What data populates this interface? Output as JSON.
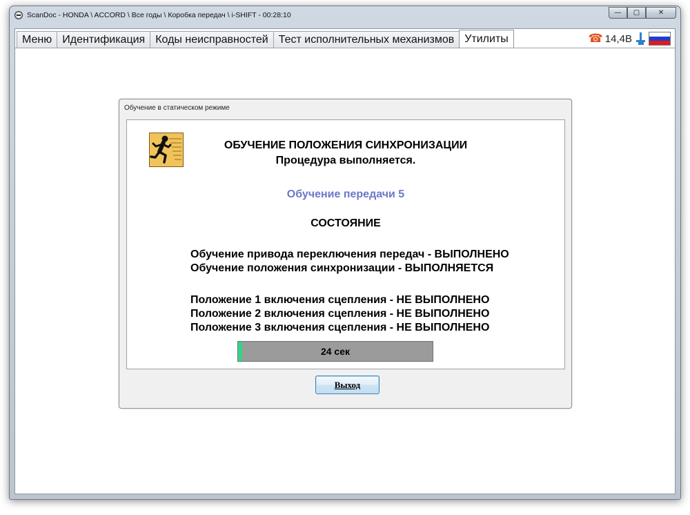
{
  "window": {
    "title": "ScanDoc - HONDA \\ ACCORD \\ Все годы \\ Коробка передач \\ i-SHIFT - 00:28:10",
    "controls": {
      "minimize": "—",
      "maximize": "▢",
      "close": "✕"
    }
  },
  "tabs": [
    {
      "label": "Меню"
    },
    {
      "label": "Идентификация"
    },
    {
      "label": "Коды неисправностей"
    },
    {
      "label": "Тест исполнительных механизмов"
    },
    {
      "label": "Утилиты",
      "active": true
    }
  ],
  "status": {
    "voltage": "14,4В",
    "phone_icon": "☎",
    "flag_colors": [
      "#ffffff",
      "#1c3fd1",
      "#e01b1b"
    ]
  },
  "dialog": {
    "title": "Обучение в статическом режиме",
    "heading_line1": "ОБУЧЕНИЕ ПОЛОЖЕНИЯ СИНХРОНИЗАЦИИ",
    "heading_line2": "Процедура выполняется.",
    "stage": "Обучение передачи 5",
    "state_label": "СОСТОЯНИЕ",
    "status_lines": [
      "Обучение привода переключения передач - ВЫПОЛНЕНО",
      "Обучение положения синхронизации - ВЫПОЛНЯЕТСЯ"
    ],
    "clutch_lines": [
      "Положение 1 включения сцепления - НЕ ВЫПОЛНЕНО",
      "Положение 2 включения сцепления - НЕ ВЫПОЛНЕНО",
      "Положение 3 включения сцепления - НЕ ВЫПОЛНЕНО"
    ],
    "progress": {
      "text": "24 сек",
      "fraction": 0.02
    },
    "exit_label": "Выход"
  },
  "colors": {
    "stage_text": "#6b78c8",
    "progress_bar": "#9b9b9b",
    "progress_fill": "#37d38a",
    "phone_icon": "#e0531c"
  }
}
